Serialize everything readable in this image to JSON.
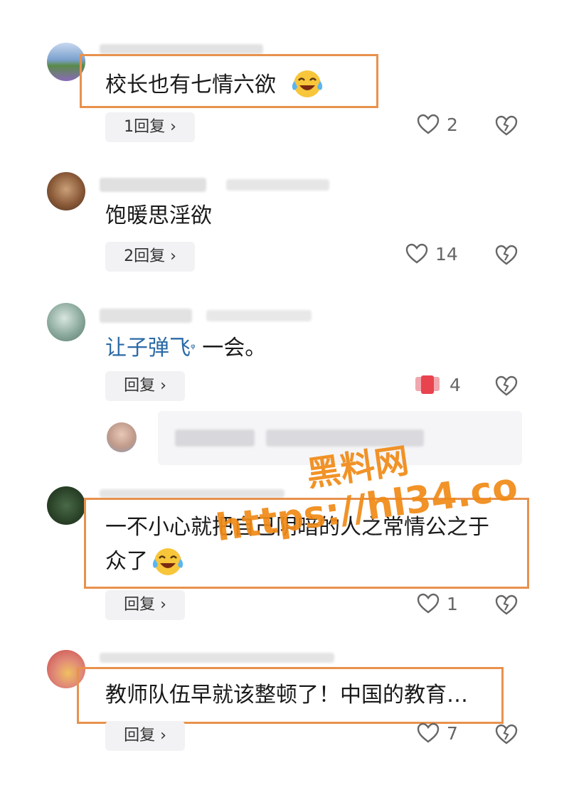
{
  "comments": [
    {
      "text": "校长也有七情六欲",
      "emoji": "laughing-crying",
      "reply_label": "1回复",
      "likes": "2"
    },
    {
      "text": "饱暖思淫欲",
      "reply_label": "2回复",
      "likes": "14"
    },
    {
      "mention": "让子弹飞",
      "text": "一会。",
      "reply_label": "回复",
      "likes": "4"
    },
    {
      "text_line1": "一不小心就把自己阴暗的人之常情公之于",
      "text_line2": "众了",
      "emoji": "laughing-crying",
      "reply_label": "回复",
      "likes": "1"
    },
    {
      "text": "教师队伍早就该整顿了！中国的教育…",
      "reply_label": "回复",
      "likes": "7"
    }
  ],
  "watermark": {
    "line1": "黑料网",
    "line2": "https://hl34.co"
  },
  "colors": {
    "highlight_box": "#e8914d",
    "watermark": "#f08a16",
    "mention": "#2b6aa6",
    "reply_bg": "#f2f2f4"
  }
}
